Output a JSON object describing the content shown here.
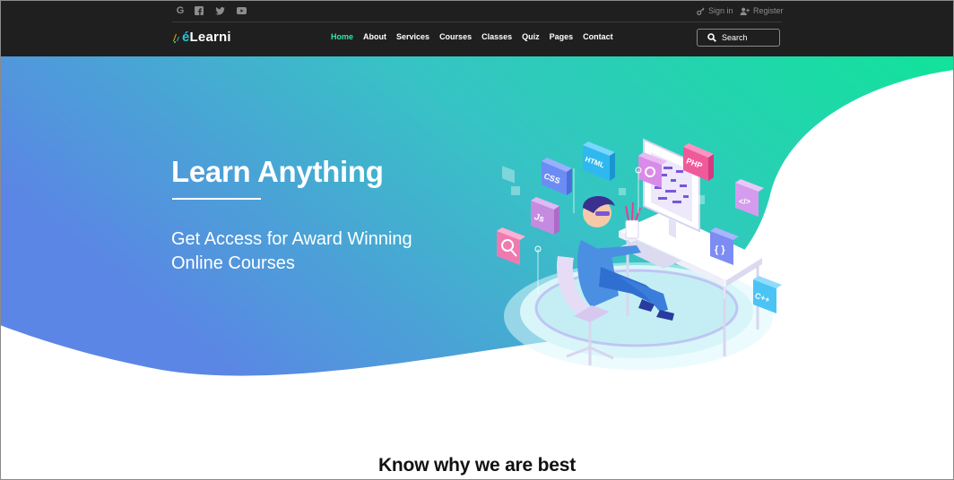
{
  "social_icons": [
    "google-icon",
    "facebook-icon",
    "twitter-icon",
    "youtube-icon"
  ],
  "auth": {
    "signin": "Sign in",
    "register": "Register"
  },
  "brand": {
    "e": "é",
    "rest": "Learni",
    "accent": "#29c2d6"
  },
  "nav": {
    "active_color": "#2ee8a8",
    "items": [
      {
        "label": "Home"
      },
      {
        "label": "About"
      },
      {
        "label": "Services"
      },
      {
        "label": "Courses"
      },
      {
        "label": "Classes"
      },
      {
        "label": "Quiz"
      },
      {
        "label": "Pages"
      },
      {
        "label": "Contact"
      }
    ]
  },
  "search": {
    "label": "Search"
  },
  "hero": {
    "title": "Learn Anything",
    "subtitle": "Get Access for Award Winning Online Courses",
    "gradient": [
      "#5b86e5",
      "#36d1b4",
      "#11e39a"
    ],
    "tiles": [
      "CSS",
      "HTML",
      "PHP",
      "Js",
      "C++"
    ]
  },
  "section": {
    "title": "Know why we are best"
  }
}
